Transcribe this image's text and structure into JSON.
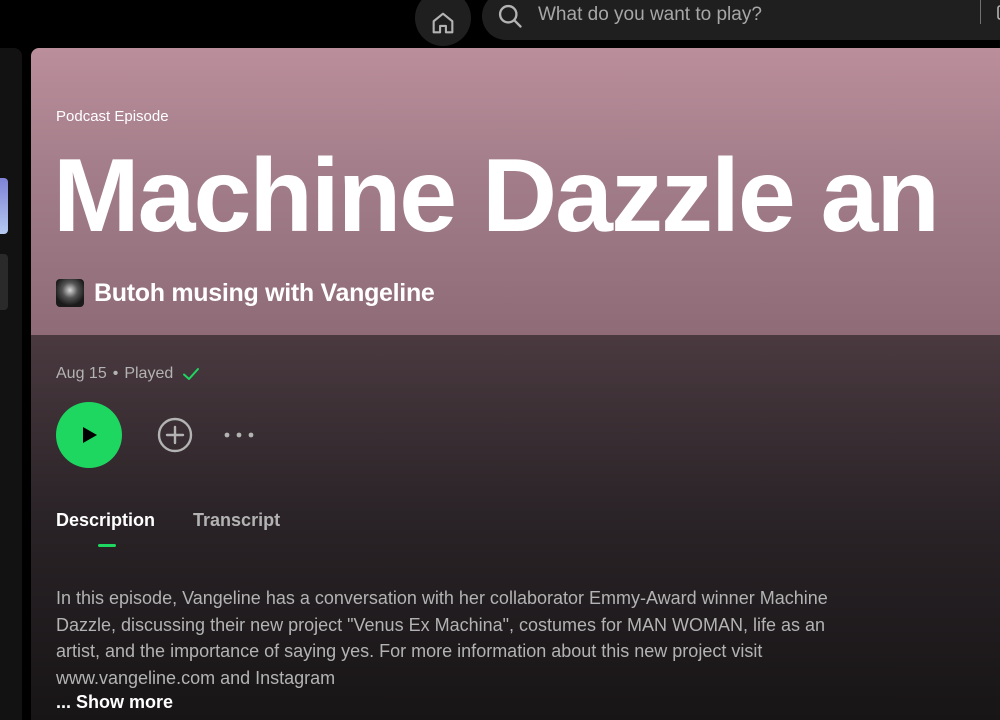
{
  "search": {
    "placeholder": "What do you want to play?"
  },
  "episode": {
    "type_label": "Podcast Episode",
    "title": "Machine Dazzle an",
    "show_name": "Butoh musing with Vangeline",
    "date": "Aug 15",
    "separator": "•",
    "status": "Played"
  },
  "tabs": [
    {
      "label": "Description",
      "active": true
    },
    {
      "label": "Transcript",
      "active": false
    }
  ],
  "description": {
    "text": "In this episode, Vangeline has a conversation with her collaborator Emmy-Award winner Machine Dazzle, discussing their new project \"Venus Ex Machina\", costumes for MAN WOMAN, life as an artist, and the importance of saying yes. For more information about this new project visit www.vangeline.com and Instagram",
    "show_more": "... Show more"
  },
  "colors": {
    "accent": "#1ed760",
    "hero_top": "#bb8e9b",
    "background": "#121212"
  },
  "icons": {
    "home": "home-icon",
    "search": "search-icon",
    "browse": "browse-icon",
    "check": "check-icon",
    "play": "play-icon",
    "add": "plus-circle-icon",
    "more": "more-icon"
  }
}
